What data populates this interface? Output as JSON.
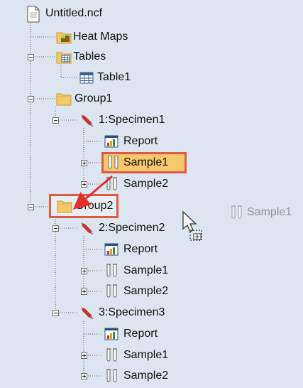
{
  "tree": {
    "root": "Untitled.ncf",
    "heat_maps": "Heat Maps",
    "tables": "Tables",
    "table1": "Table1",
    "group1": "Group1",
    "group2": "Group2",
    "g1_specimen1": "1:Specimen1",
    "g1_s1_report": "Report",
    "g1_s1_sample1": "Sample1",
    "g1_s1_sample2": "Sample2",
    "g2_specimen2": "2:Specimen2",
    "g2_s2_report": "Report",
    "g2_s2_sample1": "Sample1",
    "g2_s2_sample2": "Sample2",
    "g2_specimen3": "3:Specimen3",
    "g2_s3_report": "Report",
    "g2_s3_sample1": "Sample1",
    "g2_s3_sample2": "Sample2"
  },
  "drag": {
    "ghost_label": "Sample1"
  },
  "colors": {
    "highlight": "#e0584a",
    "panel": "#dde6f0",
    "folder": "#f5c96a"
  },
  "icons": [
    "document-icon",
    "heat-map-icon",
    "table-icon",
    "folder-icon",
    "syringe-icon",
    "report-chart-icon",
    "test-tubes-icon",
    "drag-cursor-icon"
  ]
}
